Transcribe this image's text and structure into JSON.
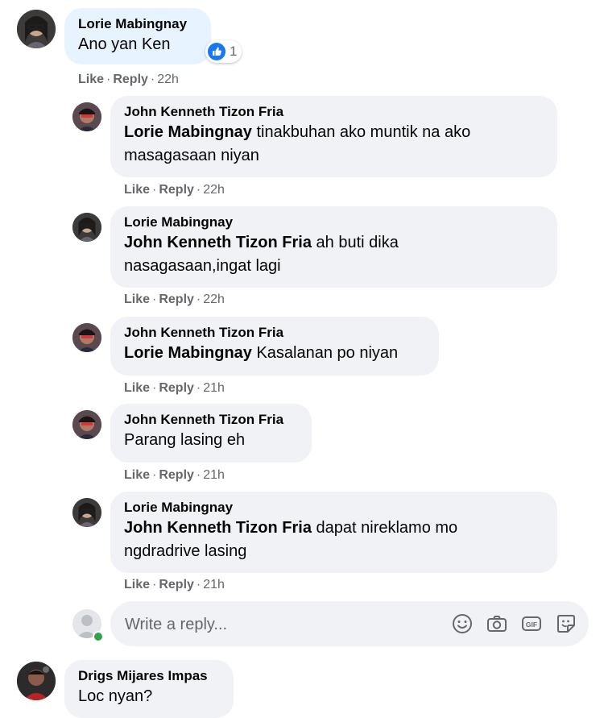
{
  "actions": {
    "like": "Like",
    "reply": "Reply",
    "sep": "·"
  },
  "comments": [
    {
      "author": "Lorie Mabingnay",
      "text": "Ano yan Ken",
      "time": "22h",
      "reactions": {
        "icon": "like-icon",
        "count": "1"
      }
    },
    {
      "author": "John Kenneth Tizon Fria",
      "mention": "Lorie Mabingnay",
      "text": " tinakbuhan ako muntik na ako masagasaan niyan",
      "time": "22h"
    },
    {
      "author": "Lorie Mabingnay",
      "mention": "John Kenneth Tizon Fria",
      "text": " ah buti dika nasagasaan,ingat lagi",
      "time": "22h"
    },
    {
      "author": "John Kenneth Tizon Fria",
      "mention": "Lorie Mabingnay",
      "text": " Kasalanan po niyan",
      "time": "21h"
    },
    {
      "author": "John Kenneth Tizon Fria",
      "text": "Parang lasing eh",
      "time": "21h"
    },
    {
      "author": "Lorie Mabingnay",
      "mention": "John Kenneth Tizon Fria",
      "text": " dapat nireklamo mo ngdradrive lasing",
      "time": "21h"
    },
    {
      "author": "Drigs Mijares Impas",
      "text": "Loc nyan?"
    }
  ],
  "reply_box": {
    "placeholder": "Write a reply...",
    "icons": [
      "emoji-icon",
      "camera-icon",
      "gif-icon",
      "sticker-icon"
    ]
  },
  "colors": {
    "like_blue": "#1877f2",
    "bubble": "#f0f2f5",
    "bubble_top": "#e7f3ff",
    "meta": "#65676b",
    "online": "#31a24c"
  }
}
